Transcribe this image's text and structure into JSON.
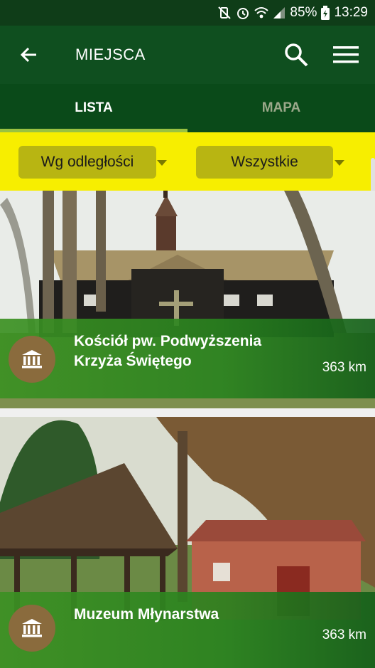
{
  "status_bar": {
    "battery_percent": "85%",
    "time": "13:29",
    "icons": [
      "mute-vibrate-icon",
      "alarm-icon",
      "wifi-icon",
      "signal-icon",
      "battery-charging-icon"
    ]
  },
  "app_bar": {
    "title": "MIEJSCA",
    "back_icon": "arrow-left-icon",
    "search_icon": "search-icon",
    "menu_icon": "hamburger-menu-icon"
  },
  "tabs": [
    {
      "label": "LISTA",
      "active": true
    },
    {
      "label": "MAPA",
      "active": false
    }
  ],
  "filters": {
    "sort_value": "Wg odległości",
    "category_value": "Wszystkie"
  },
  "places": [
    {
      "title_line1": "Kościół pw. Podwyższenia",
      "title_line2": "Krzyża Świętego",
      "distance": "363 km",
      "icon": "museum-building-icon"
    },
    {
      "title_line1": "Muzeum Młynarstwa",
      "title_line2": "",
      "distance": "363 km",
      "icon": "museum-building-icon"
    }
  ],
  "colors": {
    "status_bar": "#0f3d18",
    "app_bar": "#0f4f1f",
    "tabs_bg": "#0a4a19",
    "tab_indicator": "#9ac241",
    "filter_bar": "#f7ee00",
    "dropdown_bg": "#b8b512",
    "badge_bg": "#8a6b3d"
  }
}
